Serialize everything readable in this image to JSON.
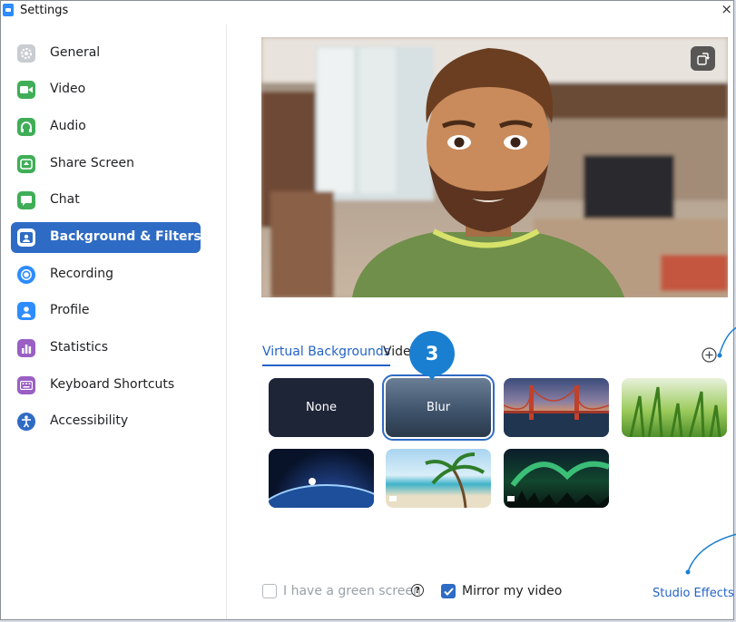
{
  "window": {
    "title": "Settings",
    "close_glyph": "×"
  },
  "sidebar": {
    "items": [
      {
        "label": "General",
        "icon": "gear-icon",
        "color": "#9aa0a6"
      },
      {
        "label": "Video",
        "icon": "video-camera-icon",
        "color": "#3fae57"
      },
      {
        "label": "Audio",
        "icon": "headphones-icon",
        "color": "#3fae57"
      },
      {
        "label": "Share Screen",
        "icon": "share-screen-icon",
        "color": "#3fae57"
      },
      {
        "label": "Chat",
        "icon": "chat-bubble-icon",
        "color": "#3fae57"
      },
      {
        "label": "Background & Filters",
        "icon": "portrait-icon",
        "color": "#2e6bc4",
        "active": true
      },
      {
        "label": "Recording",
        "icon": "record-icon",
        "color": "#2d8cff"
      },
      {
        "label": "Profile",
        "icon": "person-icon",
        "color": "#2d8cff"
      },
      {
        "label": "Statistics",
        "icon": "bar-chart-icon",
        "color": "#9a5fc4"
      },
      {
        "label": "Keyboard Shortcuts",
        "icon": "keyboard-icon",
        "color": "#9a5fc4"
      },
      {
        "label": "Accessibility",
        "icon": "accessibility-icon",
        "color": "#2e6bc4"
      }
    ]
  },
  "main": {
    "tabs": [
      {
        "label": "Virtual Backgrounds",
        "active": true
      },
      {
        "label": "Vide",
        "active": false
      }
    ],
    "step_badge": "3",
    "add_icon": "plus-circle-icon",
    "backgrounds": [
      {
        "label": "None",
        "kind": "none"
      },
      {
        "label": "Blur",
        "kind": "blur",
        "selected": true
      },
      {
        "label": "",
        "kind": "golden-gate-bridge"
      },
      {
        "label": "",
        "kind": "grass"
      },
      {
        "label": "",
        "kind": "earth-from-space"
      },
      {
        "label": "",
        "kind": "beach-palm",
        "video": true
      },
      {
        "label": "",
        "kind": "aurora",
        "video": true
      }
    ],
    "options": {
      "green_screen_label": "I have a green screen",
      "green_screen_checked": false,
      "mirror_label": "Mirror my video",
      "mirror_checked": true
    },
    "studio_effects_label": "Studio Effects"
  },
  "colors": {
    "accent": "#2e6bc4",
    "link": "#2463c7",
    "badge": "#1a7fd1"
  }
}
